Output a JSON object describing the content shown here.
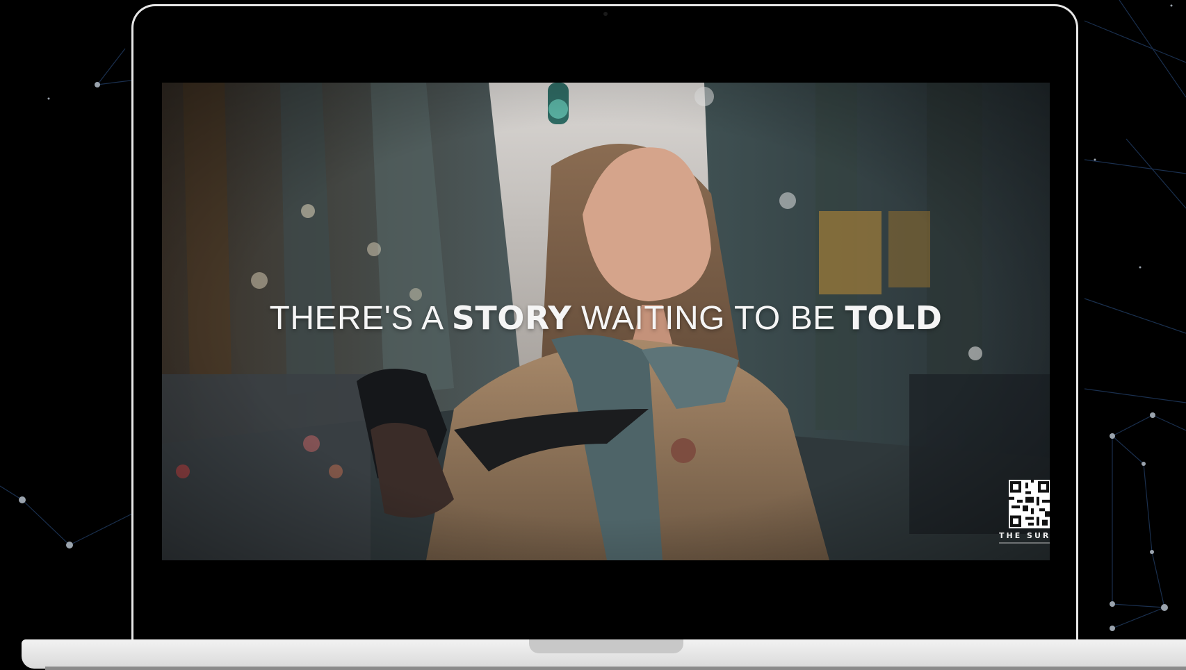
{
  "video": {
    "headline_1": "THERE'S A ",
    "headline_2": "STORY",
    "headline_3": " WAITING TO BE ",
    "headline_4": "TOLD",
    "brand_text": "THE SUR"
  },
  "icons": {
    "qr": "qr-code-icon",
    "camera": "webcam-icon"
  },
  "colors": {
    "background": "#000000",
    "laptop_frame": "#e6e6e6",
    "network_lines": "#1e3a5f",
    "headline": "#f5f5f5"
  }
}
